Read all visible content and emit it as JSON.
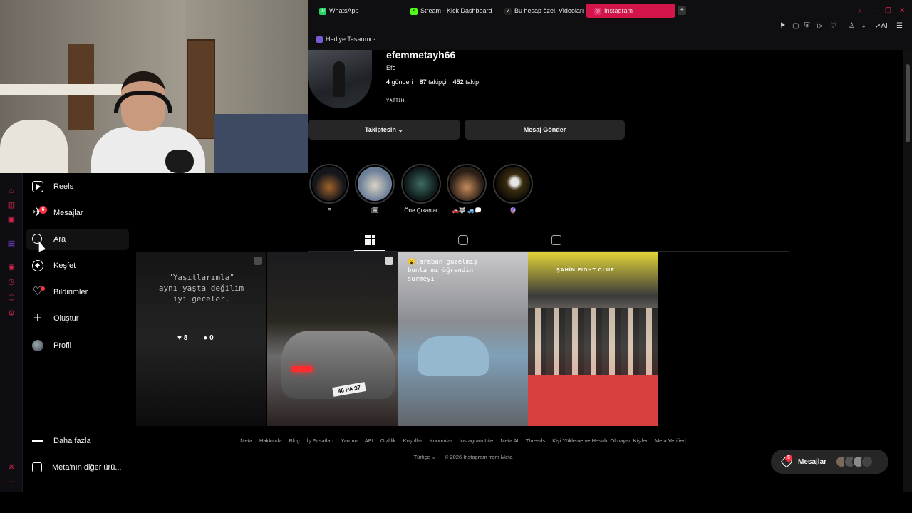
{
  "browser": {
    "tabs": [
      {
        "label": "WhatsApp",
        "icon": "whatsapp-icon",
        "color": "#25d366"
      },
      {
        "label": "Stream - Kick Dashboard",
        "icon": "kick-icon",
        "color": "#53fc18"
      },
      {
        "label": "Bu hesap özel. Videoların",
        "icon": "tiktok-icon",
        "color": "#222222"
      },
      {
        "label": "Instagram",
        "icon": "instagram-icon",
        "color": "#e1306c",
        "active": true
      }
    ],
    "bookmark": "Hediye Tasarımı -..."
  },
  "nav": {
    "items": [
      {
        "label": "Reels",
        "icon": "reels-icon"
      },
      {
        "label": "Mesajlar",
        "icon": "messenger-icon",
        "badge": "6"
      },
      {
        "label": "Ara",
        "icon": "search-icon"
      },
      {
        "label": "Keşfet",
        "icon": "compass-icon"
      },
      {
        "label": "Bildirimler",
        "icon": "heart-icon"
      },
      {
        "label": "Oluştur",
        "icon": "plus-icon"
      },
      {
        "label": "Profil",
        "icon": "avatar-icon"
      }
    ],
    "more": "Daha fazla",
    "meta_more": "Meta'nın diğer ürü..."
  },
  "profile": {
    "username": "efemmetayh66",
    "more": "···",
    "full_name": "Efe",
    "posts": "4",
    "posts_label": "gönderi",
    "followers": "87",
    "followers_label": "takipçi",
    "following": "452",
    "following_label": "takip",
    "bio": "ʏᴀᴛᴛɪʜ",
    "follow_button": "Takiptesin ⌄",
    "message_button": "Mesaj Gönder"
  },
  "highlights": [
    {
      "label": "E"
    },
    {
      "label": "🗓"
    },
    {
      "label": "Öne Çıkanlar"
    },
    {
      "label": "🚗🐺 🚙💭"
    },
    {
      "label": "🔮"
    }
  ],
  "posts": [
    {
      "text": "\"Yaşıtlarımla\"\naynı yaşta değilim\niyi geceler.",
      "likes": "8",
      "comments": "0"
    },
    {
      "plate": "46 PA 37"
    },
    {
      "text": "😮:araban guzelmiş\nbunla mı öğrendin\nsürmeyi"
    },
    {
      "sign": "ŞAHİN FIGHT CLUP"
    }
  ],
  "footer": {
    "links": [
      "Meta",
      "Hakkında",
      "Blog",
      "İş Fırsatları",
      "Yardım",
      "API",
      "Gizlilik",
      "Koşullar",
      "Konumlar",
      "Instagram Lite",
      "Meta AI",
      "Threads",
      "Kişi Yükleme ve Hesabı Olmayan Kişiler",
      "Meta Verified"
    ],
    "language": "Türkçe ⌄",
    "copyright": "© 2026 Instagram from Meta"
  },
  "messages_bubble": {
    "label": "Mesajlar",
    "badge": "5"
  },
  "colors": {
    "accent": "#d4154a",
    "badge": "#ff3040",
    "bg": "#000000"
  }
}
